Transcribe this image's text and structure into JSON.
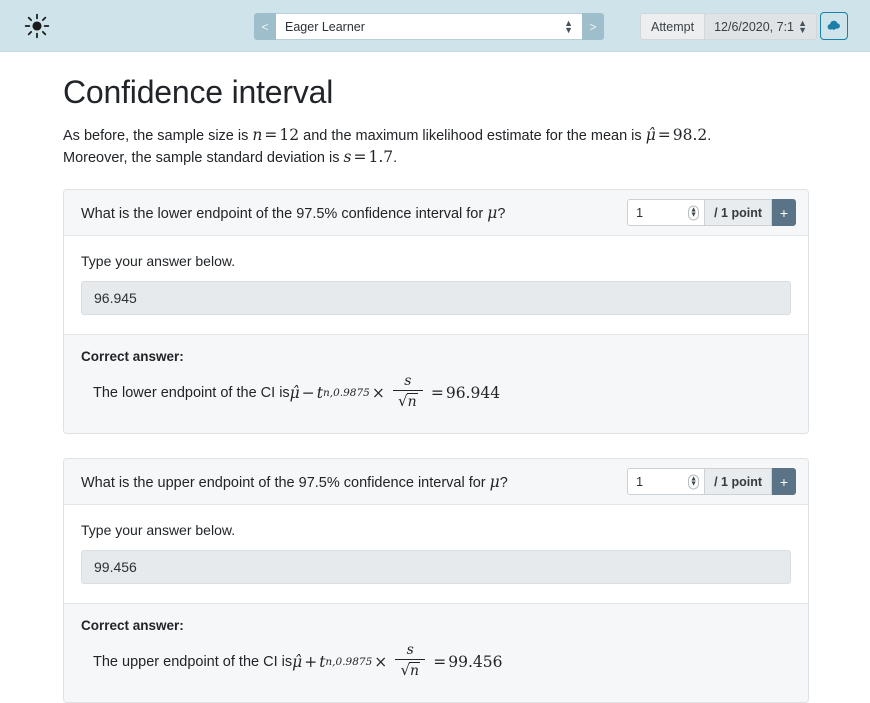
{
  "topbar": {
    "brightness_icon": "sun-icon",
    "prev_label": "<",
    "next_label": ">",
    "assignment_value": "Eager Learner",
    "attempt_label": "Attempt",
    "attempt_value": "12/6/2020, 7:1",
    "download_icon": "cloud-download-icon"
  },
  "page": {
    "title": "Confidence interval",
    "intro": {
      "p1a": "As before, the sample size is ",
      "n_sym": "n",
      "eq1": "=",
      "n_val": "12",
      "p1b": " and the maximum likelihood estimate for the mean is ",
      "mu_sym": "μ̂",
      "eq2": "=",
      "mu_val": "98.2",
      "p1c": ". Moreover, the sample standard deviation is ",
      "s_sym": "s",
      "eq3": "=",
      "s_val": "1.7",
      "p1d": "."
    }
  },
  "questions": [
    {
      "question_a": "What is the lower endpoint of the 97.5% confidence interval for ",
      "question_mu": "μ",
      "question_b": "?",
      "score_value": "1",
      "points_label": "/ 1 point",
      "plus_label": "+",
      "prompt": "Type your answer below.",
      "answer": "96.945",
      "correct_label": "Correct answer:",
      "correct": {
        "lead": "The lower endpoint of the CI is ",
        "mu_hat": "μ̂",
        "operator": "−",
        "t_sym": "t",
        "t_sub": "n,0.9875",
        "times": "×",
        "num": "s",
        "den_sqrt": "√",
        "den_var": "n",
        "equals": "=",
        "value": "96.944"
      }
    },
    {
      "question_a": "What is the upper endpoint of the 97.5% confidence interval for ",
      "question_mu": "μ",
      "question_b": "?",
      "score_value": "1",
      "points_label": "/ 1 point",
      "plus_label": "+",
      "prompt": "Type your answer below.",
      "answer": "99.456",
      "correct_label": "Correct answer:",
      "correct": {
        "lead": "The upper endpoint of the CI is ",
        "mu_hat": "μ̂",
        "operator": "+",
        "t_sym": "t",
        "t_sub": "n,0.9875",
        "times": "×",
        "num": "s",
        "den_sqrt": "√",
        "den_var": "n",
        "equals": "=",
        "value": "99.456"
      }
    }
  ],
  "colors": {
    "topbar_bg": "#cfe4ea",
    "accent_blue": "#1b7fa8",
    "plus_btn": "#5b7386",
    "answer_bg": "#e6eaed"
  }
}
